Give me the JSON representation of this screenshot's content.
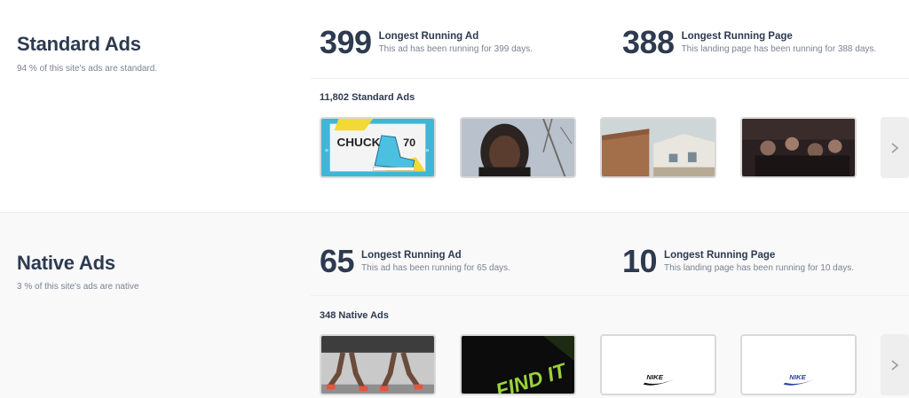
{
  "standard": {
    "title": "Standard Ads",
    "subtitle": "94 % of this site's ads are standard.",
    "longest_ad": {
      "value": "399",
      "label": "Longest Running Ad",
      "desc": "This ad has been running for 399 days."
    },
    "longest_page": {
      "value": "388",
      "label": "Longest Running Page",
      "desc": "This landing page has been running for 388 days."
    },
    "count_label": "11,802 Standard Ads",
    "thumbnails": [
      {
        "caption": "CHUCK",
        "caption2": "70"
      },
      {},
      {},
      {}
    ]
  },
  "native": {
    "title": "Native Ads",
    "subtitle": "3 % of this site's ads are native",
    "longest_ad": {
      "value": "65",
      "label": "Longest Running Ad",
      "desc": "This ad has been running for 65 days."
    },
    "longest_page": {
      "value": "10",
      "label": "Longest Running Page",
      "desc": "This landing page has been running for 10 days."
    },
    "count_label": "348 Native Ads",
    "thumbnails": [
      {},
      {
        "caption": "FIND IT"
      },
      {
        "caption": "NIKE"
      },
      {
        "caption": "NIKE"
      }
    ]
  },
  "icons": {
    "next": "chevron-right-icon"
  }
}
